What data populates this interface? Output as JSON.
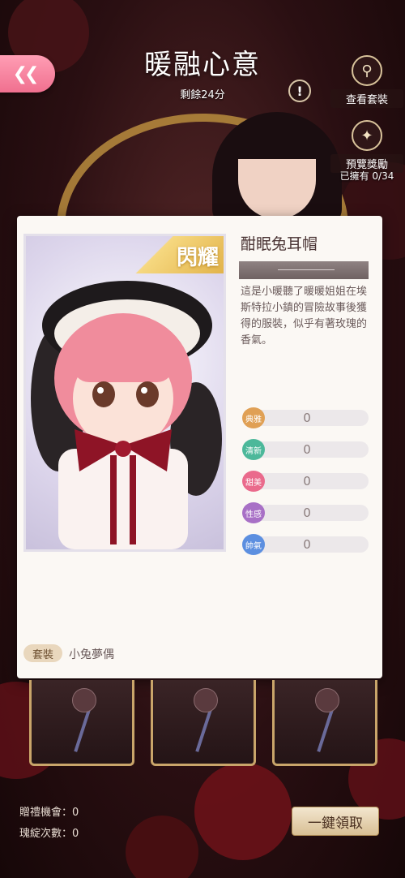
{
  "header": {
    "event_title": "暖融心意",
    "remaining": "剩餘24分"
  },
  "side_buttons": {
    "view_suit": "查看套裝",
    "preview_rewards": "預覽獎勵",
    "owned": "已擁有 0/34"
  },
  "item": {
    "rarity": "閃耀",
    "name": "酣眠兔耳帽",
    "description": "這是小暖聽了暖暖姐姐在埃斯特拉小鎮的冒險故事後獲得的服裝，似乎有著玫瑰的香氣。",
    "attributes": [
      {
        "label": "典雅",
        "value": "0",
        "color": "#e0a055"
      },
      {
        "label": "清新",
        "value": "0",
        "color": "#4cb89a"
      },
      {
        "label": "甜美",
        "value": "0",
        "color": "#ea6a8c"
      },
      {
        "label": "性感",
        "value": "0",
        "color": "#a870c6"
      },
      {
        "label": "帥氣",
        "value": "0",
        "color": "#5c8fe0"
      }
    ],
    "suit_tag": "套裝",
    "suit_name": "小兔夢偶"
  },
  "footer": {
    "gift_chances": "贈禮機會：0",
    "bloom_count": "瑰綻次數：0",
    "claim_all": "一鍵領取"
  },
  "colors": {
    "accent_pink": "#f0708f",
    "gold": "#c9a56a"
  }
}
